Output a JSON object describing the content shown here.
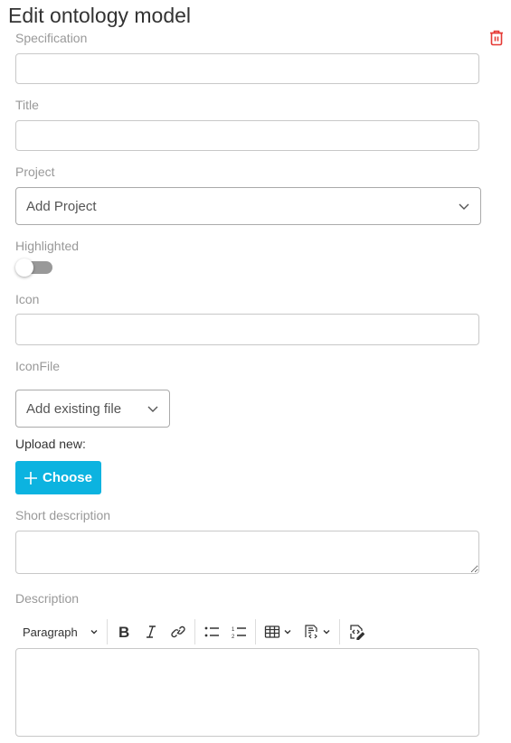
{
  "page": {
    "title": "Edit ontology model"
  },
  "actions": {
    "delete_icon": "trash-icon"
  },
  "colors": {
    "delete": "#e53935",
    "primary_button": "#0cb3e0"
  },
  "fields": {
    "specification": {
      "label": "Specification",
      "value": ""
    },
    "title": {
      "label": "Title",
      "value": ""
    },
    "project": {
      "label": "Project",
      "selected": "Add Project"
    },
    "highlighted": {
      "label": "Highlighted",
      "checked": false
    },
    "icon": {
      "label": "Icon",
      "value": ""
    },
    "icon_file": {
      "label": "IconFile",
      "selected": "Add existing file",
      "upload_label": "Upload new:",
      "choose_label": "Choose"
    },
    "short_description": {
      "label": "Short description",
      "value": ""
    },
    "description": {
      "label": "Description",
      "value": ""
    }
  },
  "editor_toolbar": {
    "heading_select": "Paragraph",
    "buttons": [
      "bold",
      "italic",
      "link",
      "bulleted-list",
      "numbered-list",
      "insert-table",
      "insert-code-block",
      "source-editing"
    ]
  }
}
